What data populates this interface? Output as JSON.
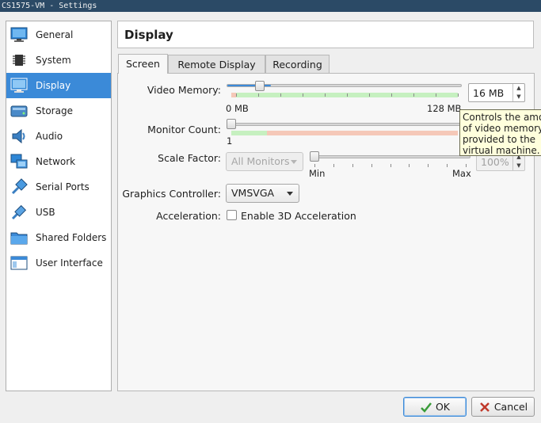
{
  "window": {
    "title": "CS1575-VM - Settings"
  },
  "sidebar": {
    "items": [
      {
        "label": "General",
        "icon": "general-icon"
      },
      {
        "label": "System",
        "icon": "system-chip-icon"
      },
      {
        "label": "Display",
        "icon": "display-monitor-icon",
        "selected": true
      },
      {
        "label": "Storage",
        "icon": "storage-icon"
      },
      {
        "label": "Audio",
        "icon": "audio-speaker-icon"
      },
      {
        "label": "Network",
        "icon": "network-icon"
      },
      {
        "label": "Serial Ports",
        "icon": "serial-port-icon"
      },
      {
        "label": "USB",
        "icon": "usb-icon"
      },
      {
        "label": "Shared Folders",
        "icon": "folder-icon"
      },
      {
        "label": "User Interface",
        "icon": "user-interface-icon"
      }
    ]
  },
  "header": {
    "title": "Display"
  },
  "tabs": [
    {
      "label": "Screen",
      "active": true
    },
    {
      "label": "Remote Display",
      "active": false
    },
    {
      "label": "Recording",
      "active": false
    }
  ],
  "screen": {
    "video_memory": {
      "label": "Video Memory:",
      "value_text": "16 MB",
      "min_label": "0 MB",
      "max_label": "128 MB",
      "fraction": 0.125
    },
    "monitor_count": {
      "label": "Monitor Count:",
      "min_label": "1",
      "fraction": 0.0
    },
    "scale_factor": {
      "label": "Scale Factor:",
      "monitor_select": "All Monitors",
      "min_label": "Min",
      "max_label": "Max",
      "value_text": "100%",
      "fraction": 0.0
    },
    "graphics_controller": {
      "label": "Graphics Controller:",
      "value": "VMSVGA"
    },
    "acceleration": {
      "label": "Acceleration:",
      "checkbox_label": "Enable 3D Acceleration",
      "checked": false
    }
  },
  "tooltip": {
    "lines": [
      "Controls the amo",
      "of video memory",
      "provided to the",
      "virtual machine."
    ]
  },
  "buttons": {
    "ok": "OK",
    "cancel": "Cancel"
  },
  "colors": {
    "accent": "#3b8ad8",
    "ok_zone": "#c6f0c0",
    "warn_zone": "#f5c8b8",
    "titlebar": "#2b4a66"
  }
}
